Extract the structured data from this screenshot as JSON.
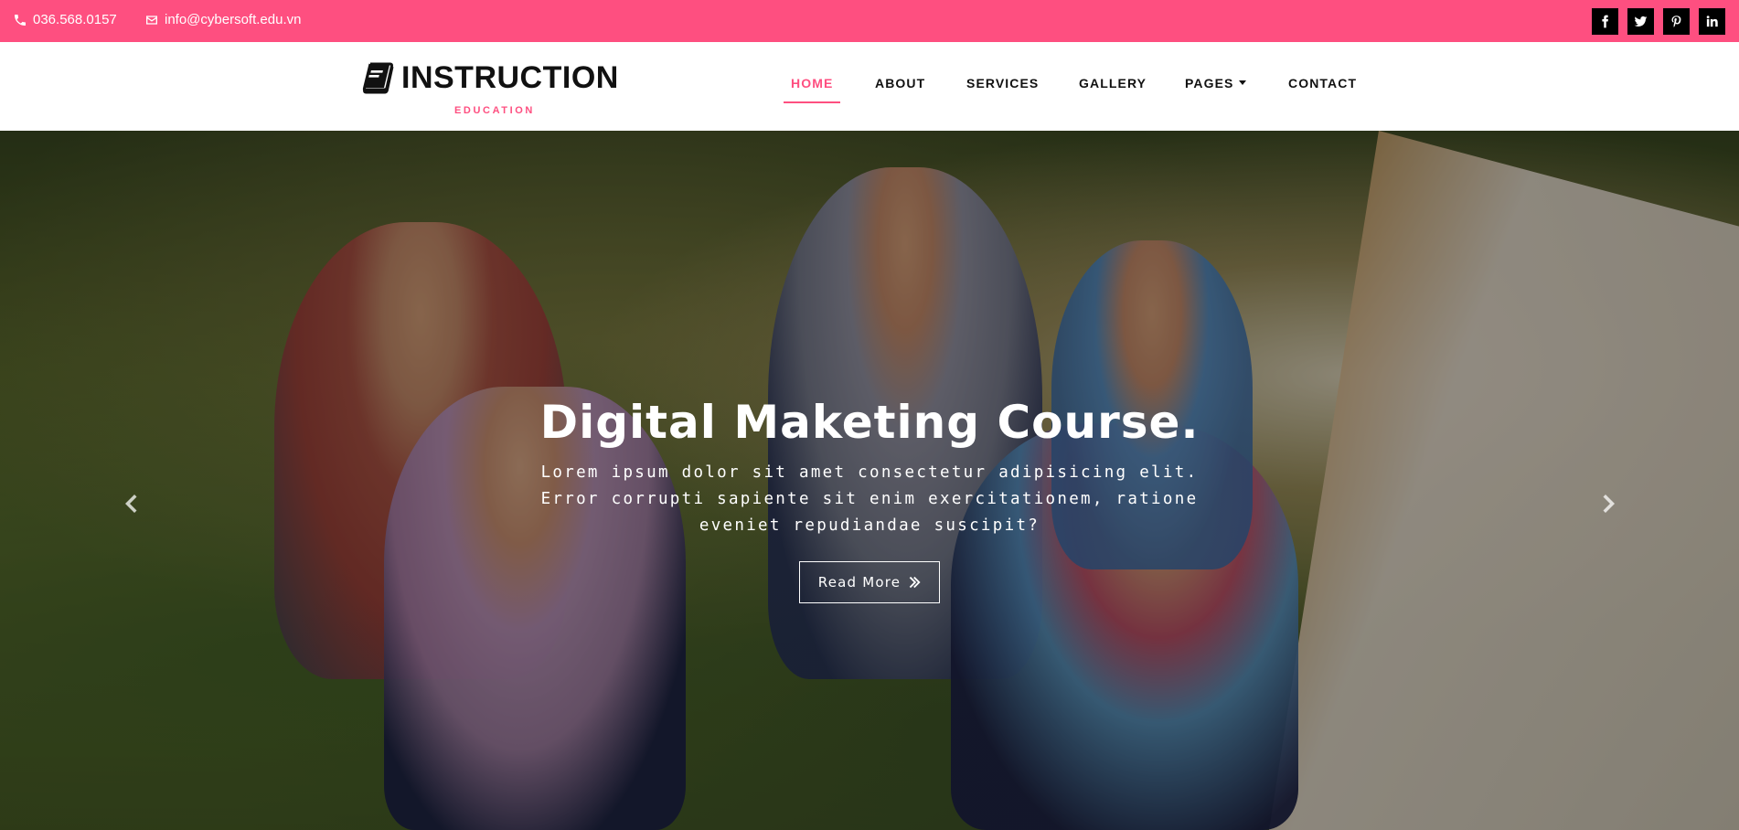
{
  "topbar": {
    "phone": "036.568.0157",
    "email": "info@cybersoft.edu.vn",
    "social": [
      {
        "icon": "facebook-icon"
      },
      {
        "icon": "twitter-icon"
      },
      {
        "icon": "pinterest-icon"
      },
      {
        "icon": "linkedin-icon"
      }
    ],
    "background": "#fe4f80"
  },
  "header": {
    "logo_title": "INSTRUCTION",
    "logo_subtitle": "EDUCATION",
    "nav": [
      {
        "label": "HOME",
        "active": true
      },
      {
        "label": "ABOUT"
      },
      {
        "label": "SERVICES"
      },
      {
        "label": "GALLERY"
      },
      {
        "label": "PAGES",
        "dropdown": true
      },
      {
        "label": "CONTACT"
      }
    ],
    "accent": "#fe4f80"
  },
  "hero": {
    "title": "Digital Maketing Course.",
    "text": "Lorem ipsum dolor sit amet consectetur adipisicing elit. Error corrupti sapiente sit enim exercitationem, ratione eveniet repudiandae suscipit?",
    "button_label": "Read More",
    "prev_icon": "chevron-left-icon",
    "next_icon": "chevron-right-icon"
  }
}
